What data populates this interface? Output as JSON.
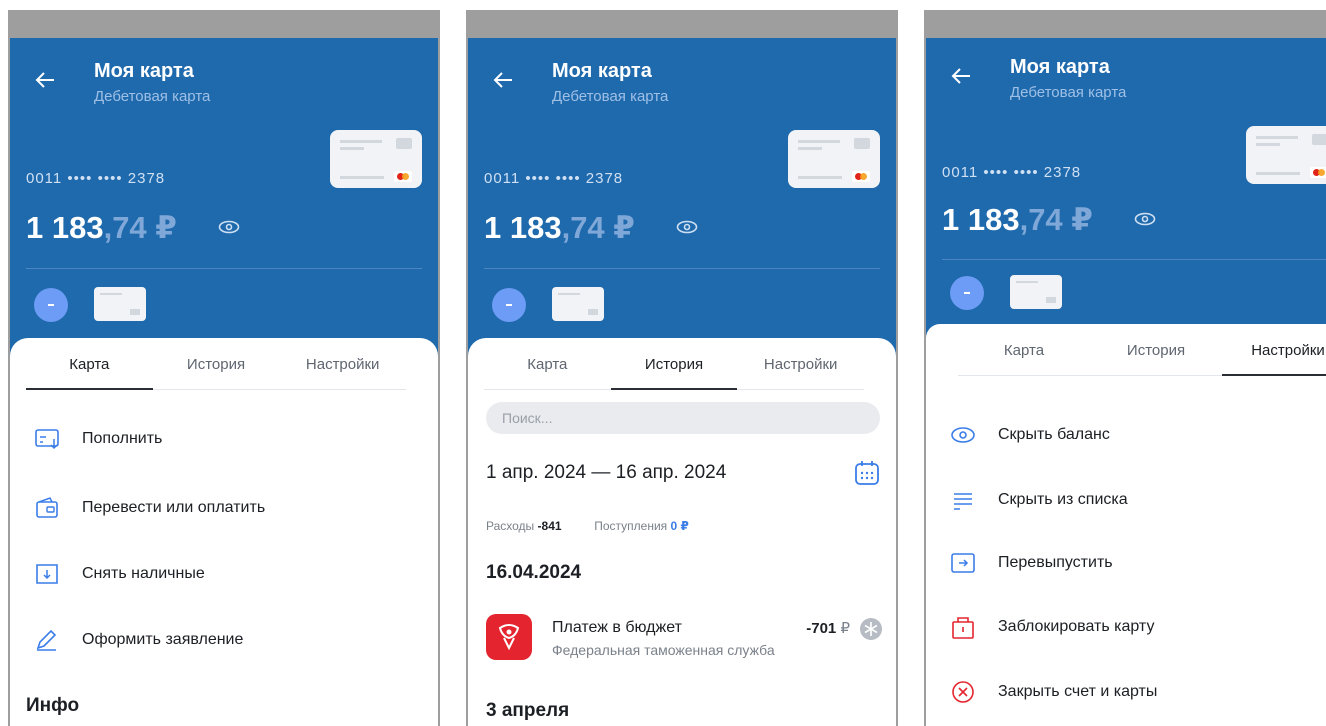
{
  "header": {
    "title": "Моя карта",
    "subtitle": "Дебетовая карта",
    "card_number": "0011 •••• •••• 2378",
    "balance_int": "1 183",
    "balance_frac": ",74 ₽"
  },
  "tabs": [
    "Карта",
    "История",
    "Настройки"
  ],
  "screen1": {
    "actions": [
      "Пополнить",
      "Перевести или оплатить",
      "Снять наличные",
      "Оформить заявление"
    ],
    "section": "Инфо"
  },
  "screen2": {
    "search_placeholder": "Поиск...",
    "date_range": "1 апр. 2024 — 16 апр. 2024",
    "expenses_label": "Расходы",
    "expenses_value": "-841",
    "income_label": "Поступления",
    "income_value": "0 ₽",
    "group_date": "16.04.2024",
    "transaction": {
      "title": "Платеж в бюджет",
      "subtitle": "Федеральная таможенная служба",
      "amount": "-701",
      "currency": "₽"
    },
    "next_group": "3 апреля"
  },
  "screen3": {
    "settings": [
      "Скрыть баланс",
      "Скрыть из списка",
      "Перевыпустить",
      "Заблокировать карту",
      "Закрыть счет и карты"
    ]
  },
  "colors": {
    "header_bg": "#1f69ad",
    "accent_icon": "#3a7de8",
    "danger_icon": "#e4252f"
  }
}
